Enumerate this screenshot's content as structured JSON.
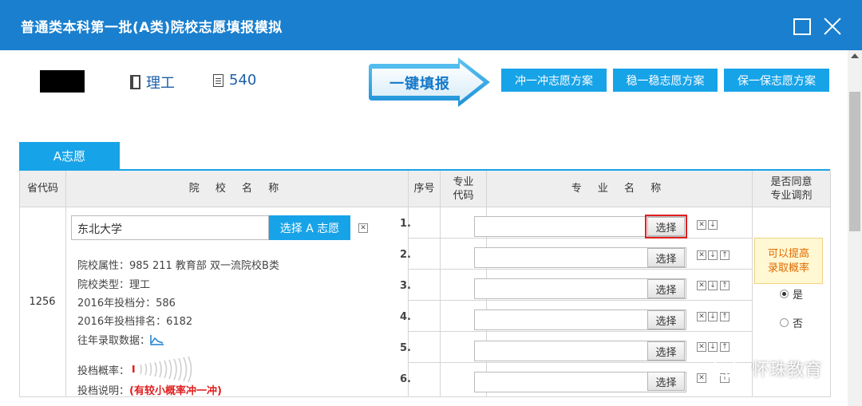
{
  "window": {
    "title": "普通类本科第一批(A类)院校志愿填报模拟"
  },
  "info": {
    "subject": "理工",
    "score": "540"
  },
  "toolbar": {
    "onekey_label": "一键填报",
    "plan_chong": "冲一冲志愿方案",
    "plan_wen": "稳一稳志愿方案",
    "plan_bao": "保一保志愿方案"
  },
  "tab": {
    "label": "A志愿"
  },
  "table": {
    "headers": {
      "province_code": "省代码",
      "school_name": "院 校 名 称",
      "seq": "序号",
      "major_code": "专业\n代码",
      "major_name": "专 业 名 称",
      "adjust": "是否同意\n专业调剂"
    },
    "province_code": "1256",
    "school": {
      "name_value": "东北大学",
      "pick_label": "选择 A 志愿",
      "attr": "院校属性：985 211 教育部 双一流院校B类",
      "type": "院校类型：理工",
      "score_2016": "2016年投档分：586",
      "rank_2016": "2016年投档排名：6182",
      "history_label": "往年录取数据：",
      "prob_label": "投档概率：",
      "note_label": "投档说明：",
      "note_value": "(有较小概率冲一冲)"
    },
    "majors": [
      {
        "seq": "1.",
        "pick": "选择"
      },
      {
        "seq": "2.",
        "pick": "选择"
      },
      {
        "seq": "3.",
        "pick": "选择"
      },
      {
        "seq": "4.",
        "pick": "选择"
      },
      {
        "seq": "5.",
        "pick": "选择"
      },
      {
        "seq": "6.",
        "pick": "选择"
      }
    ],
    "adjust": {
      "tip": "可以提高\n录取概率",
      "yes": "是",
      "no": "否",
      "selected": "是"
    }
  },
  "watermark": {
    "text": "怀珠教育"
  },
  "colors": {
    "titlebar": "#1a7fce",
    "accent": "#17a3e8",
    "warning": "#e02020"
  }
}
